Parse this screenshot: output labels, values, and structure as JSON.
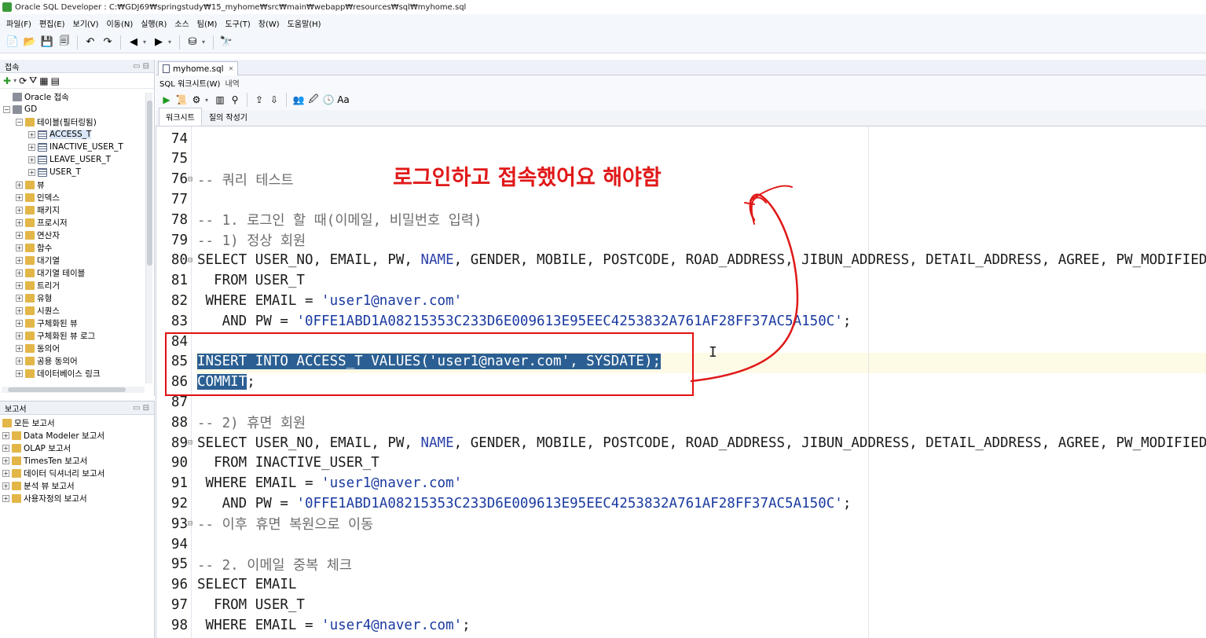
{
  "window": {
    "title": "Oracle SQL Developer : C:₩GDJ69₩springstudy₩15_myhome₩src₩main₩webapp₩resources₩sql₩myhome.sql"
  },
  "menu": [
    "파일(F)",
    "편집(E)",
    "보기(V)",
    "이동(N)",
    "실행(R)",
    "소스",
    "팀(M)",
    "도구(T)",
    "창(W)",
    "도움말(H)"
  ],
  "connections_panel": {
    "title": "접속",
    "tree": [
      {
        "label": "Oracle 접속",
        "level": 0,
        "icon": "database-icon",
        "expander": ""
      },
      {
        "label": "GD",
        "level": 0,
        "icon": "connection-icon",
        "expander": "−"
      },
      {
        "label": "테이블(필터링됨)",
        "level": 1,
        "icon": "folder-icon",
        "expander": "−"
      },
      {
        "label": "ACCESS_T",
        "level": 2,
        "icon": "table-icon",
        "expander": "+",
        "selected": true
      },
      {
        "label": "INACTIVE_USER_T",
        "level": 2,
        "icon": "table-icon",
        "expander": "+"
      },
      {
        "label": "LEAVE_USER_T",
        "level": 2,
        "icon": "table-icon",
        "expander": "+"
      },
      {
        "label": "USER_T",
        "level": 2,
        "icon": "table-icon",
        "expander": "+"
      },
      {
        "label": "뷰",
        "level": 1,
        "icon": "folder-icon",
        "expander": "+"
      },
      {
        "label": "인덱스",
        "level": 1,
        "icon": "folder-icon",
        "expander": "+"
      },
      {
        "label": "패키지",
        "level": 1,
        "icon": "folder-icon",
        "expander": "+"
      },
      {
        "label": "프로시저",
        "level": 1,
        "icon": "folder-icon",
        "expander": "+"
      },
      {
        "label": "연산자",
        "level": 1,
        "icon": "folder-icon",
        "expander": "+"
      },
      {
        "label": "함수",
        "level": 1,
        "icon": "folder-icon",
        "expander": "+"
      },
      {
        "label": "대기열",
        "level": 1,
        "icon": "folder-icon",
        "expander": "+"
      },
      {
        "label": "대기열 테이블",
        "level": 1,
        "icon": "folder-icon",
        "expander": "+"
      },
      {
        "label": "트리거",
        "level": 1,
        "icon": "folder-icon",
        "expander": "+"
      },
      {
        "label": "유형",
        "level": 1,
        "icon": "folder-icon",
        "expander": "+"
      },
      {
        "label": "시퀀스",
        "level": 1,
        "icon": "folder-icon",
        "expander": "+"
      },
      {
        "label": "구체화된 뷰",
        "level": 1,
        "icon": "folder-icon",
        "expander": "+"
      },
      {
        "label": "구체화된 뷰 로그",
        "level": 1,
        "icon": "folder-icon",
        "expander": "+"
      },
      {
        "label": "동의어",
        "level": 1,
        "icon": "folder-icon",
        "expander": "+"
      },
      {
        "label": "공용 동의어",
        "level": 1,
        "icon": "folder-icon",
        "expander": "+"
      },
      {
        "label": "데이터베이스 링크",
        "level": 1,
        "icon": "folder-icon",
        "expander": "+"
      }
    ]
  },
  "reports_panel": {
    "title": "보고서",
    "tree": [
      {
        "label": "모든 보고서",
        "level": 0,
        "expander": ""
      },
      {
        "label": "Data Modeler 보고서",
        "level": 0,
        "expander": "+"
      },
      {
        "label": "OLAP 보고서",
        "level": 0,
        "expander": "+"
      },
      {
        "label": "TimesTen 보고서",
        "level": 0,
        "expander": "+"
      },
      {
        "label": "데이터 딕셔너리 보고서",
        "level": 0,
        "expander": "+"
      },
      {
        "label": "분석 뷰 보고서",
        "level": 0,
        "expander": "+"
      },
      {
        "label": "사용자정의 보고서",
        "level": 0,
        "expander": "+"
      }
    ]
  },
  "editor": {
    "tab_label": "myhome.sql",
    "subtabs": [
      "SQL 워크시트(W)",
      "내역"
    ],
    "worksheet_tabs": [
      "워크시트",
      "질의 작성기"
    ],
    "lines": [
      {
        "n": "74",
        "fold": "",
        "parts": []
      },
      {
        "n": "75",
        "fold": "",
        "parts": []
      },
      {
        "n": "76",
        "fold": "⊟",
        "parts": [
          {
            "t": "-- 쿼리 테스트",
            "c": "cmt"
          }
        ]
      },
      {
        "n": "77",
        "fold": "",
        "parts": []
      },
      {
        "n": "78",
        "fold": "",
        "parts": [
          {
            "t": "-- 1. 로그인 할 때(이메일, 비밀번호 입력)",
            "c": "cmt"
          }
        ]
      },
      {
        "n": "79",
        "fold": "",
        "parts": [
          {
            "t": "-- 1) 정상 회원",
            "c": "cmt"
          }
        ]
      },
      {
        "n": "80",
        "fold": "⊟",
        "parts": [
          {
            "t": "SELECT USER_NO, EMAIL, PW, ",
            "c": "kw"
          },
          {
            "t": "NAME",
            "c": "name-kw"
          },
          {
            "t": ", GENDER, MOBILE, POSTCODE, ROAD_ADDRESS, JIBUN_ADDRESS, DETAIL_ADDRESS, AGREE, PW_MODIFIED_AT",
            "c": "kw"
          }
        ]
      },
      {
        "n": "81",
        "fold": "",
        "parts": [
          {
            "t": "  FROM USER_T",
            "c": "kw"
          }
        ]
      },
      {
        "n": "82",
        "fold": "",
        "parts": [
          {
            "t": " WHERE EMAIL = ",
            "c": "kw"
          },
          {
            "t": "'user1@naver.com'",
            "c": "str"
          }
        ]
      },
      {
        "n": "83",
        "fold": "",
        "parts": [
          {
            "t": "   AND PW = ",
            "c": "kw"
          },
          {
            "t": "'0FFE1ABD1A08215353C233D6E009613E95EEC4253832A761AF28FF37AC5A150C'",
            "c": "str"
          },
          {
            "t": ";",
            "c": "kw"
          }
        ]
      },
      {
        "n": "84",
        "fold": "",
        "parts": []
      },
      {
        "n": "85",
        "fold": "",
        "parts": [
          {
            "t": "INSERT INTO ACCESS_T VALUES('user1@naver.com', SYSDATE);",
            "c": "sel"
          }
        ]
      },
      {
        "n": "86",
        "fold": "",
        "parts": [
          {
            "t": "COMMIT",
            "c": "sel"
          },
          {
            "t": ";",
            "c": "kw"
          }
        ]
      },
      {
        "n": "87",
        "fold": "",
        "parts": []
      },
      {
        "n": "88",
        "fold": "",
        "parts": [
          {
            "t": "-- 2) 휴면 회원",
            "c": "cmt"
          }
        ]
      },
      {
        "n": "89",
        "fold": "⊟",
        "parts": [
          {
            "t": "SELECT USER_NO, EMAIL, PW, ",
            "c": "kw"
          },
          {
            "t": "NAME",
            "c": "name-kw"
          },
          {
            "t": ", GENDER, MOBILE, POSTCODE, ROAD_ADDRESS, JIBUN_ADDRESS, DETAIL_ADDRESS, AGREE, PW_MODIFIED_AT",
            "c": "kw"
          }
        ]
      },
      {
        "n": "90",
        "fold": "",
        "parts": [
          {
            "t": "  FROM INACTIVE_USER_T",
            "c": "kw"
          }
        ]
      },
      {
        "n": "91",
        "fold": "",
        "parts": [
          {
            "t": " WHERE EMAIL = ",
            "c": "kw"
          },
          {
            "t": "'user1@naver.com'",
            "c": "str"
          }
        ]
      },
      {
        "n": "92",
        "fold": "",
        "parts": [
          {
            "t": "   AND PW = ",
            "c": "kw"
          },
          {
            "t": "'0FFE1ABD1A08215353C233D6E009613E95EEC4253832A761AF28FF37AC5A150C'",
            "c": "str"
          },
          {
            "t": ";",
            "c": "kw"
          }
        ]
      },
      {
        "n": "93",
        "fold": "⊟",
        "parts": [
          {
            "t": "-- 이후 휴면 복원으로 이동",
            "c": "cmt"
          }
        ]
      },
      {
        "n": "94",
        "fold": "",
        "parts": []
      },
      {
        "n": "95",
        "fold": "",
        "parts": [
          {
            "t": "-- 2. 이메일 중복 체크",
            "c": "cmt"
          }
        ]
      },
      {
        "n": "96",
        "fold": "",
        "parts": [
          {
            "t": "SELECT EMAIL",
            "c": "kw"
          }
        ]
      },
      {
        "n": "97",
        "fold": "",
        "parts": [
          {
            "t": "  FROM USER_T",
            "c": "kw"
          }
        ]
      },
      {
        "n": "98",
        "fold": "",
        "parts": [
          {
            "t": " WHERE EMAIL = ",
            "c": "kw"
          },
          {
            "t": "'user4@naver.com'",
            "c": "str"
          },
          {
            "t": ";",
            "c": "kw"
          }
        ]
      }
    ]
  },
  "annotation": {
    "text": "로그인하고 접속했어요 해야함",
    "color": "#e01818"
  }
}
